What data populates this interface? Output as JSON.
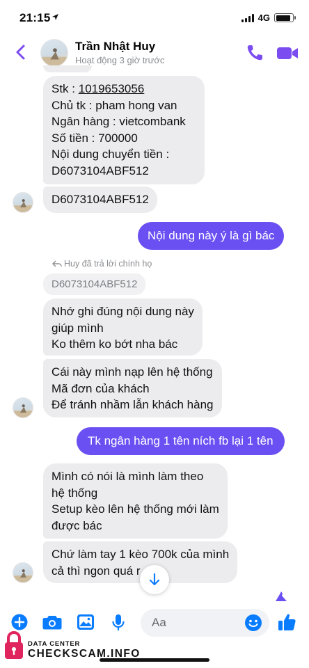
{
  "status_bar": {
    "time": "21:15",
    "network": "4G",
    "battery_level": 0.9
  },
  "header": {
    "name": "Trần Nhật Huy",
    "status": "Hoạt động 3 giờ trước"
  },
  "messages": {
    "bank_account": "Stk : ",
    "bank_account_number": "1019653056",
    "bank_holder": "Chủ tk : pham hong van",
    "bank_name": "Ngân hàng : vietcombank",
    "bank_amount": "Số tiền : 700000",
    "bank_transfer_label": "Nội dung chuyển tiền :",
    "bank_transfer_code": "D6073104ABF512",
    "code_message": "D6073104ABF512",
    "sent_question": "Nội dung này ý là gì bác",
    "reply_label": "Huy đã trả lời chính họ",
    "reply_quote": "D6073104ABF512",
    "msg_remember_1": "Nhớ ghi đúng nội dung này",
    "msg_remember_2": "giúp mình",
    "msg_remember_3": "Ko thêm ko bớt nha bác",
    "msg_system_1": "Cái này mình nạp lên hệ thống",
    "msg_system_2": "Mã đơn của khách",
    "msg_system_3": "Để tránh nhầm lẫn khách hàng",
    "sent_bank_name": "Tk ngân hàng 1 tên ních fb lại 1 tên",
    "msg_setup_1": "Mình có nói là mình làm theo",
    "msg_setup_2": "hệ thống",
    "msg_setup_3": "Setup kèo lên hệ thống mới làm",
    "msg_setup_4": "được bác",
    "msg_manual_1": "Chứ làm tay 1 kèo 700k của mình",
    "msg_manual_2": "cả thì ngon quá r"
  },
  "composer": {
    "placeholder": "Aa"
  },
  "watermark": {
    "top": "DATA CENTER",
    "brand": "CHECKSCAM.INFO"
  },
  "colors": {
    "accent": "#7b4cf0",
    "outgoing_bubble": "#6a50f2",
    "incoming_bubble": "#ececee",
    "composer_icon": "#0a7cff",
    "watermark_lock": "#e0245e"
  },
  "icons": [
    "chevron-left-icon",
    "phone-icon",
    "video-camera-icon",
    "reply-arrow-icon",
    "arrow-down-icon",
    "plus-circle-icon",
    "camera-icon",
    "photo-icon",
    "microphone-icon",
    "emoji-icon",
    "thumbs-up-icon",
    "lock-icon"
  ]
}
